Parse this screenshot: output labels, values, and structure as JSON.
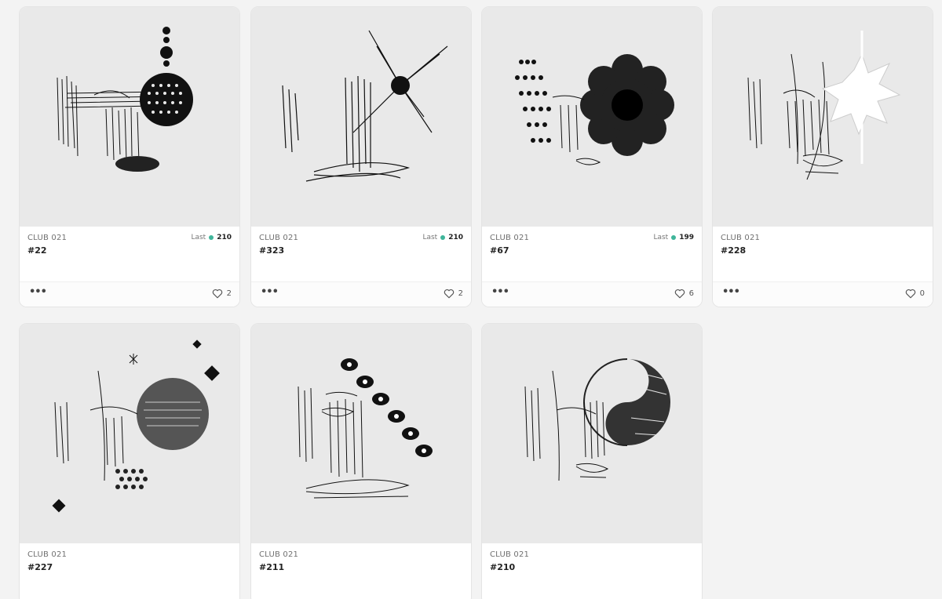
{
  "cards": [
    {
      "collection": "CLUB 021",
      "token": "#22",
      "last_label": "Last",
      "last_price": "210",
      "likes": "2",
      "art": "halftone-orb"
    },
    {
      "collection": "CLUB 021",
      "token": "#323",
      "last_label": "Last",
      "last_price": "210",
      "likes": "2",
      "art": "burst"
    },
    {
      "collection": "CLUB 021",
      "token": "#67",
      "last_label": "Last",
      "last_price": "199",
      "likes": "6",
      "art": "flower"
    },
    {
      "collection": "CLUB 021",
      "token": "#228",
      "likes": "0",
      "art": "white-splash"
    },
    {
      "collection": "CLUB 021",
      "token": "#227",
      "art": "moon-diamonds"
    },
    {
      "collection": "CLUB 021",
      "token": "#211",
      "art": "eyes-arc"
    },
    {
      "collection": "CLUB 021",
      "token": "#210",
      "art": "yin-yang"
    }
  ],
  "icons": {
    "more": "more-dots-icon",
    "like": "heart-icon",
    "currency": "eth-dot-icon"
  },
  "colors": {
    "accent": "#3fb59a",
    "art_bg": "#e9e9e9"
  }
}
